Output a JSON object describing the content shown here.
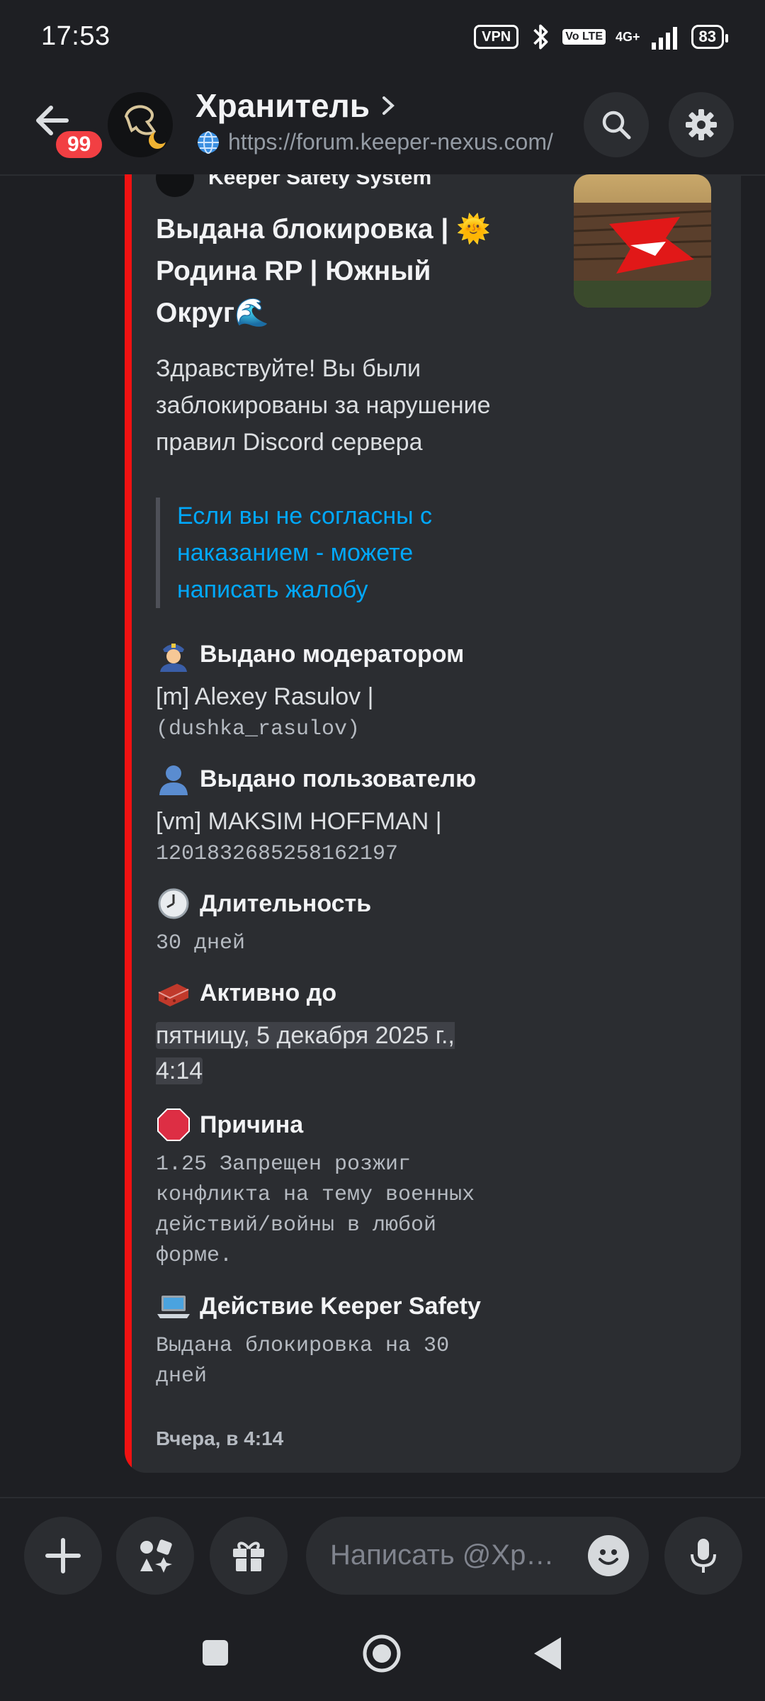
{
  "status_bar": {
    "time": "17:53",
    "vpn": "VPN",
    "volte": "Vo LTE",
    "network": "4G+",
    "battery": "83"
  },
  "header": {
    "badge_count": "99",
    "title": "Хранитель",
    "url": "https://forum.keeper-nexus.com/"
  },
  "embed": {
    "accent_color": "#f01212",
    "author": "Keeper Safety System",
    "title": "Выдана блокировка | 🌞Родина RP | Южный Округ🌊",
    "description": "Здравствуйте! Вы были заблокированы за нарушение правил Discord сервера",
    "quote": "Если вы не согласны с наказанием - можете написать жалобу",
    "fields": [
      {
        "name": "Выдано модератором",
        "icon": "police-officer-emoji",
        "value_main": "[m] Alexey Rasulov |",
        "value_mono": "(dushka_rasulov)"
      },
      {
        "name": "Выдано пользователю",
        "icon": "user-silhouette-emoji",
        "value_main": "[vm] MAKSIM HOFFMAN |",
        "value_mono": "1201832685258162197"
      },
      {
        "name": "Длительность",
        "icon": "clock-emoji",
        "value_mono": "30 дней"
      },
      {
        "name": "Активно до",
        "icon": "brick-emoji",
        "value_main": "пятницу, 5 декабря 2025 г., 4:14"
      },
      {
        "name": "Причина",
        "icon": "stop-sign-emoji",
        "value_mono": "1.25 Запрещен розжиг конфликта на тему военных действий/войны в любой форме."
      },
      {
        "name": "Действие Keeper Safety",
        "icon": "laptop-emoji",
        "value_mono": "Выдана блокировка на 30 дней"
      }
    ],
    "timestamp": "Вчера, в 4:14"
  },
  "composer": {
    "placeholder": "Написать @Хр…"
  }
}
